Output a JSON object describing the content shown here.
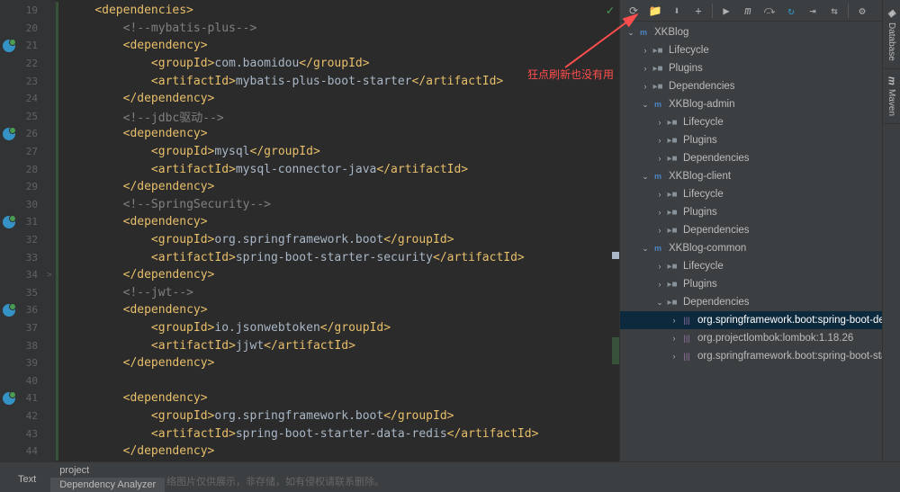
{
  "annotation": "狂点刷新也没有用",
  "code_lines": [
    {
      "line": 19,
      "indent": 1,
      "segs": [
        {
          "t": "tag",
          "v": "<dependencies>"
        }
      ]
    },
    {
      "line": 20,
      "indent": 2,
      "segs": [
        {
          "t": "comment",
          "v": "<!--mybatis-plus-->"
        }
      ]
    },
    {
      "line": 21,
      "indent": 2,
      "segs": [
        {
          "t": "tag",
          "v": "<dependency>"
        }
      ],
      "icon": true
    },
    {
      "line": 22,
      "indent": 3,
      "segs": [
        {
          "t": "tag",
          "v": "<groupId>"
        },
        {
          "t": "text",
          "v": "com.baomidou"
        },
        {
          "t": "tag",
          "v": "</groupId>"
        }
      ]
    },
    {
      "line": 23,
      "indent": 3,
      "segs": [
        {
          "t": "tag",
          "v": "<artifactId>"
        },
        {
          "t": "text",
          "v": "mybatis-plus-boot-starter"
        },
        {
          "t": "tag",
          "v": "</artifactId>"
        }
      ]
    },
    {
      "line": 24,
      "indent": 2,
      "segs": [
        {
          "t": "tag",
          "v": "</dependency>"
        }
      ]
    },
    {
      "line": 25,
      "indent": 2,
      "segs": [
        {
          "t": "comment",
          "v": "<!--jdbc驱动-->"
        }
      ]
    },
    {
      "line": 26,
      "indent": 2,
      "segs": [
        {
          "t": "tag",
          "v": "<dependency>"
        }
      ],
      "icon": true
    },
    {
      "line": 27,
      "indent": 3,
      "segs": [
        {
          "t": "tag",
          "v": "<groupId>"
        },
        {
          "t": "text",
          "v": "mysql"
        },
        {
          "t": "tag",
          "v": "</groupId>"
        }
      ]
    },
    {
      "line": 28,
      "indent": 3,
      "segs": [
        {
          "t": "tag",
          "v": "<artifactId>"
        },
        {
          "t": "text",
          "v": "mysql-connector-java"
        },
        {
          "t": "tag",
          "v": "</artifactId>"
        }
      ]
    },
    {
      "line": 29,
      "indent": 2,
      "segs": [
        {
          "t": "tag",
          "v": "</dependency>"
        }
      ]
    },
    {
      "line": 30,
      "indent": 2,
      "segs": [
        {
          "t": "comment",
          "v": "<!--SpringSecurity-->"
        }
      ]
    },
    {
      "line": 31,
      "indent": 2,
      "segs": [
        {
          "t": "tag",
          "v": "<dependency>"
        }
      ],
      "icon": true
    },
    {
      "line": 32,
      "indent": 3,
      "segs": [
        {
          "t": "tag",
          "v": "<groupId>"
        },
        {
          "t": "text",
          "v": "org.springframework.boot"
        },
        {
          "t": "tag",
          "v": "</groupId>"
        }
      ]
    },
    {
      "line": 33,
      "indent": 3,
      "segs": [
        {
          "t": "tag",
          "v": "<artifactId>"
        },
        {
          "t": "text",
          "v": "spring-boot-starter-security"
        },
        {
          "t": "tag",
          "v": "</artifactId>"
        }
      ]
    },
    {
      "line": 34,
      "indent": 2,
      "segs": [
        {
          "t": "tag",
          "v": "</dependency>"
        }
      ],
      "fold": ">"
    },
    {
      "line": 35,
      "indent": 2,
      "segs": [
        {
          "t": "comment",
          "v": "<!--jwt-->"
        }
      ]
    },
    {
      "line": 36,
      "indent": 2,
      "segs": [
        {
          "t": "tag",
          "v": "<dependency>"
        }
      ],
      "icon": true
    },
    {
      "line": 37,
      "indent": 3,
      "segs": [
        {
          "t": "tag",
          "v": "<groupId>"
        },
        {
          "t": "text",
          "v": "io.jsonwebtoken"
        },
        {
          "t": "tag",
          "v": "</groupId>"
        }
      ]
    },
    {
      "line": 38,
      "indent": 3,
      "segs": [
        {
          "t": "tag",
          "v": "<artifactId>"
        },
        {
          "t": "text",
          "v": "jjwt"
        },
        {
          "t": "tag",
          "v": "</artifactId>"
        }
      ]
    },
    {
      "line": 39,
      "indent": 2,
      "segs": [
        {
          "t": "tag",
          "v": "</dependency>"
        }
      ]
    },
    {
      "line": 40,
      "indent": 0,
      "segs": []
    },
    {
      "line": 41,
      "indent": 2,
      "segs": [
        {
          "t": "tag",
          "v": "<dependency>"
        }
      ],
      "icon": true
    },
    {
      "line": 42,
      "indent": 3,
      "segs": [
        {
          "t": "tag",
          "v": "<groupId>"
        },
        {
          "t": "text",
          "v": "org.springframework.boot"
        },
        {
          "t": "tag",
          "v": "</groupId>"
        }
      ]
    },
    {
      "line": 43,
      "indent": 3,
      "segs": [
        {
          "t": "tag",
          "v": "<artifactId>"
        },
        {
          "t": "text",
          "v": "spring-boot-starter-data-redis"
        },
        {
          "t": "tag",
          "v": "</artifactId>"
        }
      ]
    },
    {
      "line": 44,
      "indent": 2,
      "segs": [
        {
          "t": "tag",
          "v": "</dependency>"
        }
      ]
    }
  ],
  "toolbar": [
    {
      "name": "refresh-icon",
      "glyph": "⟳"
    },
    {
      "name": "open-icon",
      "glyph": "📁"
    },
    {
      "name": "download-icon",
      "glyph": "⬇"
    },
    {
      "name": "add-icon",
      "glyph": "+"
    },
    {
      "sep": true
    },
    {
      "name": "run-icon",
      "glyph": "▶"
    },
    {
      "name": "m-icon",
      "glyph": "m",
      "italic": true
    },
    {
      "name": "skip-icon",
      "glyph": "⤼"
    },
    {
      "name": "sync-icon",
      "glyph": "↻",
      "color": "#3592c4"
    },
    {
      "name": "collapse-icon",
      "glyph": "⇥"
    },
    {
      "name": "expand-icon",
      "glyph": "⇆"
    },
    {
      "sep": true
    },
    {
      "name": "settings-icon",
      "glyph": "⚙"
    }
  ],
  "tree": [
    {
      "depth": 0,
      "arrow": "v",
      "icon": "maven",
      "label": "XKBlog"
    },
    {
      "depth": 1,
      "arrow": ">",
      "icon": "folder",
      "label": "Lifecycle"
    },
    {
      "depth": 1,
      "arrow": ">",
      "icon": "folder",
      "label": "Plugins"
    },
    {
      "depth": 1,
      "arrow": ">",
      "icon": "folder",
      "label": "Dependencies"
    },
    {
      "depth": 1,
      "arrow": "v",
      "icon": "maven",
      "label": "XKBlog-admin"
    },
    {
      "depth": 2,
      "arrow": ">",
      "icon": "folder",
      "label": "Lifecycle"
    },
    {
      "depth": 2,
      "arrow": ">",
      "icon": "folder",
      "label": "Plugins"
    },
    {
      "depth": 2,
      "arrow": ">",
      "icon": "folder",
      "label": "Dependencies"
    },
    {
      "depth": 1,
      "arrow": "v",
      "icon": "maven",
      "label": "XKBlog-client"
    },
    {
      "depth": 2,
      "arrow": ">",
      "icon": "folder",
      "label": "Lifecycle"
    },
    {
      "depth": 2,
      "arrow": ">",
      "icon": "folder",
      "label": "Plugins"
    },
    {
      "depth": 2,
      "arrow": ">",
      "icon": "folder",
      "label": "Dependencies"
    },
    {
      "depth": 1,
      "arrow": "v",
      "icon": "maven",
      "label": "XKBlog-common"
    },
    {
      "depth": 2,
      "arrow": ">",
      "icon": "folder",
      "label": "Lifecycle"
    },
    {
      "depth": 2,
      "arrow": ">",
      "icon": "folder",
      "label": "Plugins"
    },
    {
      "depth": 2,
      "arrow": "v",
      "icon": "folder",
      "label": "Dependencies"
    },
    {
      "depth": 3,
      "arrow": ">",
      "icon": "lib",
      "label": "org.springframework.boot:spring-boot-devtoo",
      "selected": true
    },
    {
      "depth": 3,
      "arrow": ">",
      "icon": "lib",
      "label": "org.projectlombok:lombok:1.18.26"
    },
    {
      "depth": 3,
      "arrow": ">",
      "icon": "lib",
      "label": "org.springframework.boot:spring-boot-starter-"
    }
  ],
  "side_tabs": [
    {
      "name": "database-tab",
      "label": "Database",
      "icon": "◈"
    },
    {
      "name": "maven-tab",
      "label": "Maven",
      "icon": "m"
    }
  ],
  "bottom": {
    "tab1": "project",
    "tab2": "Dependency Analyzer",
    "left_text": "Text",
    "watermark": "络图片仅供展示，非存储，如有侵权请联系删除。"
  }
}
